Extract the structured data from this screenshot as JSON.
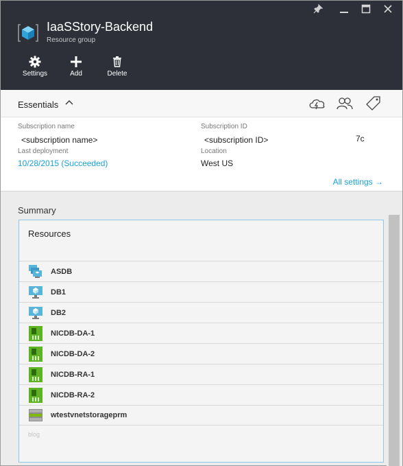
{
  "window_controls": {
    "pin_icon": "pin-icon",
    "minimize_icon": "minimize-icon",
    "maximize_icon": "maximize-icon",
    "close_icon": "close-icon"
  },
  "header": {
    "title": "IaaSStory-Backend",
    "subtitle": "Resource group",
    "commands": [
      {
        "label": "Settings",
        "icon": "gear-icon"
      },
      {
        "label": "Add",
        "icon": "plus-icon"
      },
      {
        "label": "Delete",
        "icon": "trash-icon"
      }
    ]
  },
  "essentials": {
    "title": "Essentials",
    "subscription_name_label": "Subscription name",
    "subscription_name_value": "<subscription name>",
    "subscription_id_label": "Subscription ID",
    "subscription_id_value": "<subscription ID>",
    "subscription_id_suffix": "7c",
    "last_deployment_label": "Last deployment",
    "last_deployment_value": "10/28/2015 (Succeeded)",
    "location_label": "Location",
    "location_value": "West US",
    "all_settings": "All settings →"
  },
  "summary": {
    "label": "Summary",
    "resources_title": "Resources",
    "resources": [
      {
        "name": "ASDB",
        "icon": "availability-set-icon"
      },
      {
        "name": "DB1",
        "icon": "virtual-machine-icon"
      },
      {
        "name": "DB2",
        "icon": "virtual-machine-icon"
      },
      {
        "name": "NICDB-DA-1",
        "icon": "network-interface-icon"
      },
      {
        "name": "NICDB-DA-2",
        "icon": "network-interface-icon"
      },
      {
        "name": "NICDB-RA-1",
        "icon": "network-interface-icon"
      },
      {
        "name": "NICDB-RA-2",
        "icon": "network-interface-icon"
      },
      {
        "name": "wtestvnetstorageprm",
        "icon": "storage-account-icon"
      }
    ],
    "faded_text": "blog"
  },
  "colors": {
    "header_bg": "#2d3038",
    "link": "#1aa0d8",
    "box_border": "#8cc6e8",
    "nic_green": "#5db323",
    "vm_blue": "#59b4d9"
  }
}
